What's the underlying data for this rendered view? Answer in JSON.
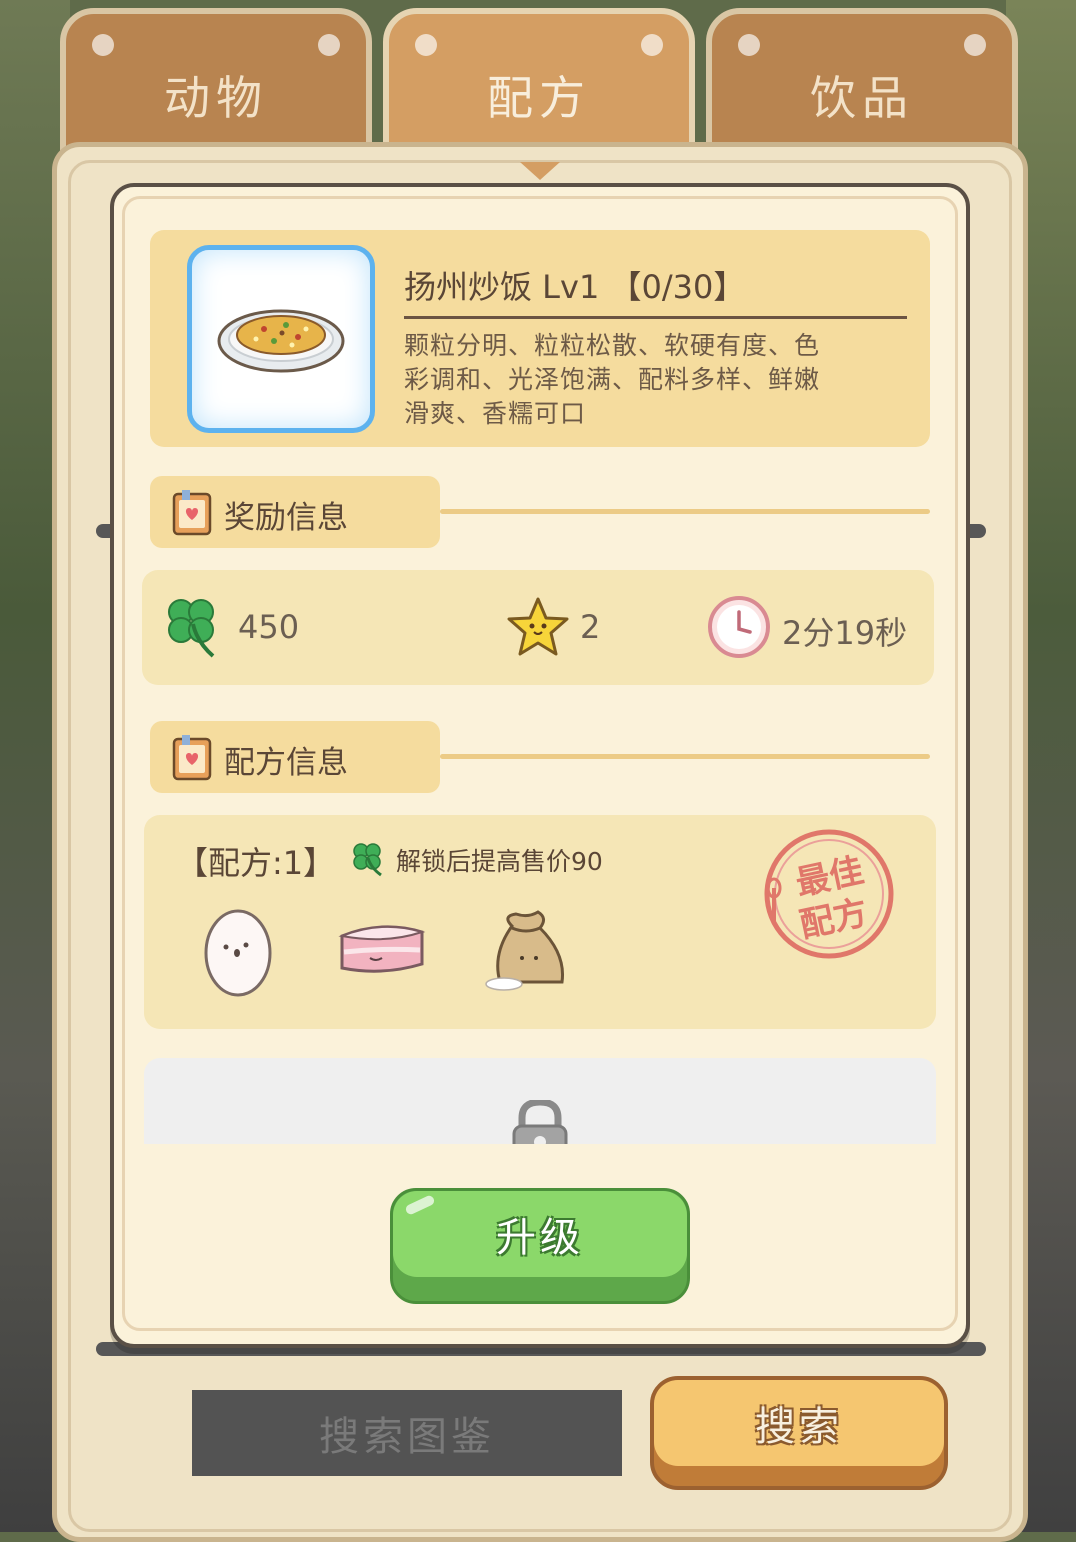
{
  "tabs": [
    {
      "label": "动物",
      "active": false
    },
    {
      "label": "配方",
      "active": true
    },
    {
      "label": "饮品",
      "active": false
    }
  ],
  "dish": {
    "title": "扬州炒饭 Lv1 【0/30】",
    "description_lines": [
      "颗粒分明、粒粒松散、软硬有度、色",
      "彩调和、光泽饱满、配料多样、鲜嫩",
      "滑爽、香糯可口"
    ],
    "icon": "fried-rice-plate"
  },
  "reward_section": {
    "title": "奖励信息",
    "clover_value": "450",
    "star_value": "2",
    "time_value": "2分19秒"
  },
  "recipe_section": {
    "title": "配方信息",
    "recipe_label": "【配方:1】",
    "unlock_hint": "解锁后提高售价90",
    "ingredients": [
      "egg-icon",
      "pork-belly-icon",
      "flour-sack-icon"
    ],
    "stamp_line1": "最佳",
    "stamp_line2": "配方"
  },
  "buttons": {
    "upgrade": "升级",
    "search_atlas": "搜索图鉴",
    "search": "搜索"
  },
  "colors": {
    "panel_bg": "#fbf2da",
    "header_bg": "#f5dc9e",
    "reward_bg": "#f5e6b6",
    "upgrade_green": "#8bd86a",
    "search_orange": "#f5c670",
    "stamp_red": "#e0776a"
  }
}
